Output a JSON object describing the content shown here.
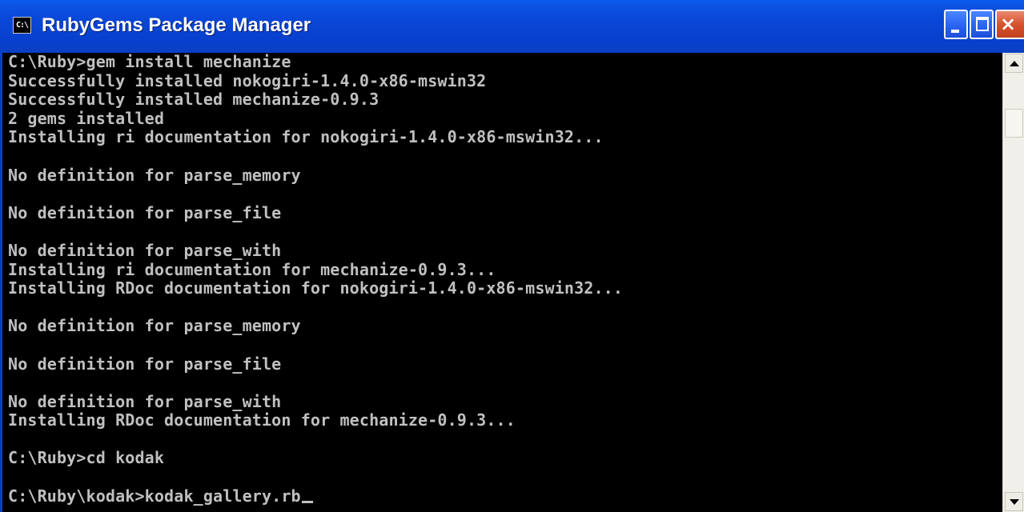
{
  "window": {
    "title": "RubyGems Package Manager",
    "icon_label": "C:\\",
    "icon": "console-icon",
    "minimize_icon": "minimize-icon",
    "maximize_icon": "maximize-icon",
    "close_icon": "close-icon",
    "close_label": "×"
  },
  "console": {
    "lines": [
      "C:\\Ruby>gem install mechanize",
      "Successfully installed nokogiri-1.4.0-x86-mswin32",
      "Successfully installed mechanize-0.9.3",
      "2 gems installed",
      "Installing ri documentation for nokogiri-1.4.0-x86-mswin32...",
      "",
      "No definition for parse_memory",
      "",
      "No definition for parse_file",
      "",
      "No definition for parse_with",
      "Installing ri documentation for mechanize-0.9.3...",
      "Installing RDoc documentation for nokogiri-1.4.0-x86-mswin32...",
      "",
      "No definition for parse_memory",
      "",
      "No definition for parse_file",
      "",
      "No definition for parse_with",
      "Installing RDoc documentation for mechanize-0.9.3...",
      "",
      "C:\\Ruby>cd kodak",
      "",
      "C:\\Ruby\\kodak>kodak_gallery.rb"
    ]
  },
  "scrollbar": {
    "up_icon": "scroll-up-arrow-icon",
    "down_icon": "scroll-down-arrow-icon"
  }
}
